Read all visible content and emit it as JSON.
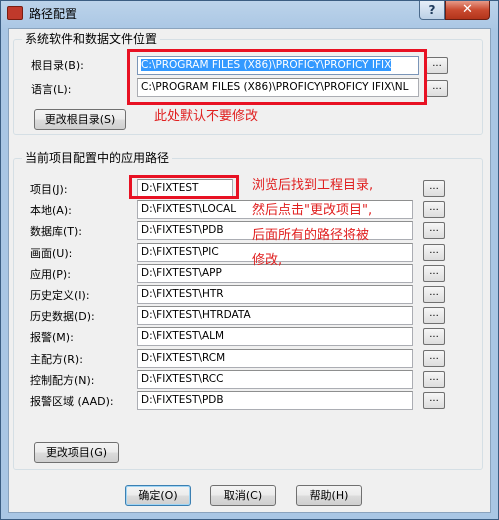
{
  "window": {
    "title": "路径配置",
    "help_label": "?",
    "close_label": "✕",
    "icon": "app-icon"
  },
  "system_group": {
    "caption": "系统软件和数据文件位置",
    "root_label": "根目录(B):",
    "root_value": "C:\\PROGRAM FILES (X86)\\PROFICY\\PROFICY IFIX",
    "lang_label": "语言(L):",
    "lang_value": "C:\\PROGRAM FILES (X86)\\PROFICY\\PROFICY IFIX\\NL",
    "change_root_button": "更改根目录(S)"
  },
  "project_group": {
    "caption": "当前项目配置中的应用路径",
    "rows": [
      {
        "label": "项目(J):",
        "value": "D:\\FIXTEST"
      },
      {
        "label": "本地(A):",
        "value": "D:\\FIXTEST\\LOCAL"
      },
      {
        "label": "数据库(T):",
        "value": "D:\\FIXTEST\\PDB"
      },
      {
        "label": "画面(U):",
        "value": "D:\\FIXTEST\\PIC"
      },
      {
        "label": "应用(P):",
        "value": "D:\\FIXTEST\\APP"
      },
      {
        "label": "历史定义(I):",
        "value": "D:\\FIXTEST\\HTR"
      },
      {
        "label": "历史数据(D):",
        "value": "D:\\FIXTEST\\HTRDATA"
      },
      {
        "label": "报警(M):",
        "value": "D:\\FIXTEST\\ALM"
      },
      {
        "label": "主配方(R):",
        "value": "D:\\FIXTEST\\RCM"
      },
      {
        "label": "控制配方(N):",
        "value": "D:\\FIXTEST\\RCC"
      },
      {
        "label": "报警区域 (AAD):",
        "value": "D:\\FIXTEST\\PDB"
      }
    ],
    "change_project_button": "更改项目(G)"
  },
  "browse_label": "...",
  "annotations": {
    "note1": "此处默认不要修改",
    "note2_lines": [
      "浏览后找到工程目录,",
      "然后点击\"更改项目\",",
      "后面所有的路径将被",
      "修改,"
    ]
  },
  "footer": {
    "ok_button": "确定(O)",
    "cancel_button": "取消(C)",
    "help_button": "帮助(H)"
  },
  "colors": {
    "annotation_red": "#e02020",
    "selection_blue": "#3399ff"
  }
}
